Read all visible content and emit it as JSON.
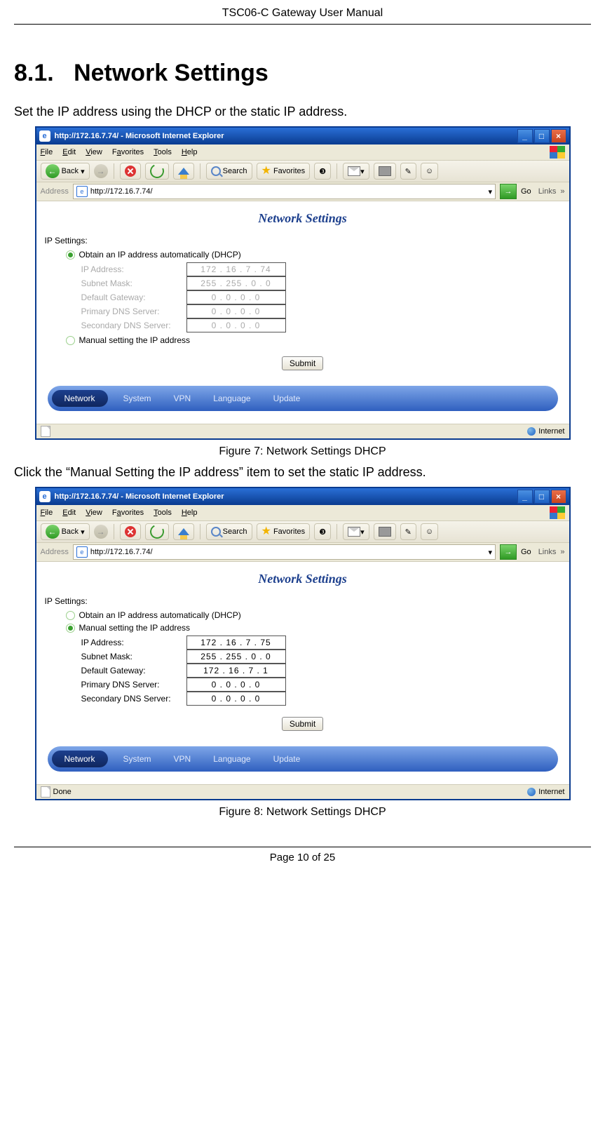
{
  "doc": {
    "header": "TSC06-C Gateway User Manual",
    "section_number": "8.1.",
    "section_title": "Network Settings",
    "intro1": "Set the IP address using the DHCP or the static IP address.",
    "caption1": "Figure 7: Network Settings DHCP",
    "intro2": "Click the “Manual Setting the IP address” item to set the static IP address.",
    "caption2": "Figure 8: Network Settings DHCP",
    "footer": "Page 10 of 25"
  },
  "browser": {
    "title": "http://172.16.7.74/ - Microsoft Internet Explorer",
    "menu": {
      "file": "File",
      "edit": "Edit",
      "view": "View",
      "favorites": "Favorites",
      "tools": "Tools",
      "help": "Help"
    },
    "toolbar": {
      "back": "Back",
      "search": "Search",
      "favorites": "Favorites"
    },
    "addr_label": "Address",
    "addr_value": "http://172.16.7.74/",
    "go": "Go",
    "links": "Links",
    "status_done": "Done",
    "status_zone": "Internet"
  },
  "content": {
    "page_title": "Network Settings",
    "ip_settings": "IP Settings:",
    "opt_dhcp": "Obtain an IP address automatically (DHCP)",
    "opt_manual": "Manual setting the IP address",
    "labels": {
      "ip": "IP Address:",
      "mask": "Subnet Mask:",
      "gw": "Default Gateway:",
      "dns1": "Primary DNS Server:",
      "dns2": "Secondary DNS Server:"
    },
    "submit": "Submit",
    "nav": {
      "network": "Network",
      "system": "System",
      "vpn": "VPN",
      "language": "Language",
      "update": "Update"
    }
  },
  "fig1": {
    "ip": "172 . 16  .  7   . 74",
    "mask": "255 . 255 .  0   .  0",
    "gw": "0  .  0  .  0  .  0",
    "dns1": "0  .  0  .  0  .  0",
    "dns2": "0  .  0  .  0  .  0"
  },
  "fig2": {
    "ip": "172 . 16  .  7   . 75",
    "mask": "255 . 255 .  0   .  0",
    "gw": "172 . 16  .  7   .  1",
    "dns1": "0  .  0  .  0  .  0",
    "dns2": "0  .  0  .  0  .  0"
  }
}
